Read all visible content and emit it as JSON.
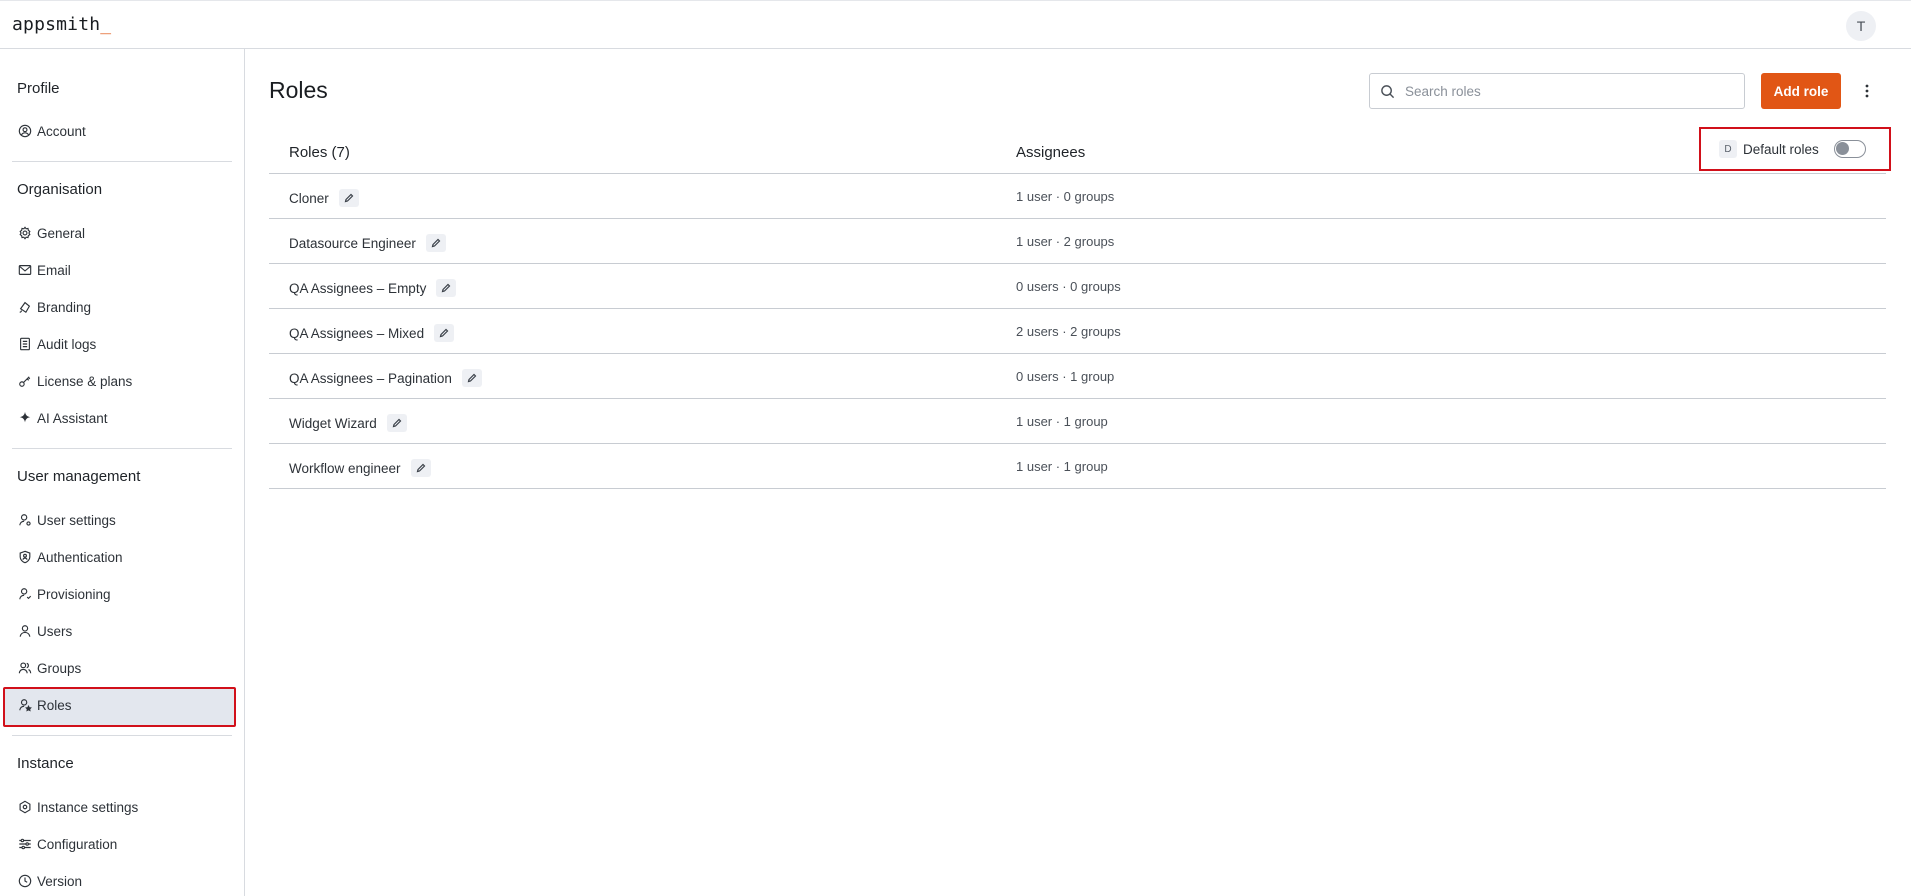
{
  "app": {
    "logo": "appsmith",
    "logo_caret": "_",
    "avatar_initial": "T"
  },
  "sidebar": {
    "profile": {
      "title": "Profile",
      "items": [
        {
          "label": "Account",
          "icon": "user-circle-icon"
        }
      ]
    },
    "organisation": {
      "title": "Organisation",
      "items": [
        {
          "label": "General",
          "icon": "gear-icon"
        },
        {
          "label": "Email",
          "icon": "mail-icon"
        },
        {
          "label": "Branding",
          "icon": "paint-icon"
        },
        {
          "label": "Audit logs",
          "icon": "file-list-icon"
        },
        {
          "label": "License & plans",
          "icon": "key-icon"
        },
        {
          "label": "AI Assistant",
          "icon": "sparkle-icon"
        }
      ]
    },
    "user_management": {
      "title": "User management",
      "items": [
        {
          "label": "User settings",
          "icon": "user-settings-icon"
        },
        {
          "label": "Authentication",
          "icon": "shield-user-icon"
        },
        {
          "label": "Provisioning",
          "icon": "user-sync-icon"
        },
        {
          "label": "Users",
          "icon": "user-icon"
        },
        {
          "label": "Groups",
          "icon": "group-icon"
        },
        {
          "label": "Roles",
          "icon": "user-star-icon",
          "active": true
        }
      ]
    },
    "instance": {
      "title": "Instance",
      "items": [
        {
          "label": "Instance settings",
          "icon": "hexagon-gear-icon"
        },
        {
          "label": "Configuration",
          "icon": "sliders-icon"
        },
        {
          "label": "Version",
          "icon": "clock-check-icon"
        }
      ]
    }
  },
  "main": {
    "title": "Roles",
    "search_placeholder": "Search roles",
    "add_button": "Add role",
    "table": {
      "col_roles": "Roles (7)",
      "col_assignees": "Assignees",
      "default_badge": "D",
      "default_label": "Default roles",
      "default_toggle_on": false,
      "rows": [
        {
          "name": "Cloner",
          "assignees": "1 user · 0 groups"
        },
        {
          "name": "Datasource Engineer",
          "assignees": "1 user · 2 groups"
        },
        {
          "name": "QA Assignees – Empty",
          "assignees": "0 users · 0 groups"
        },
        {
          "name": "QA Assignees – Mixed",
          "assignees": "2 users · 2 groups"
        },
        {
          "name": "QA Assignees – Pagination",
          "assignees": "0 users · 1 group"
        },
        {
          "name": "Widget Wizard",
          "assignees": "1 user · 1 group"
        },
        {
          "name": "Workflow engineer",
          "assignees": "1 user · 1 group"
        }
      ]
    }
  },
  "colors": {
    "accent": "#e15615",
    "highlight": "#d1101a",
    "active_bg": "#e3e7ee"
  }
}
